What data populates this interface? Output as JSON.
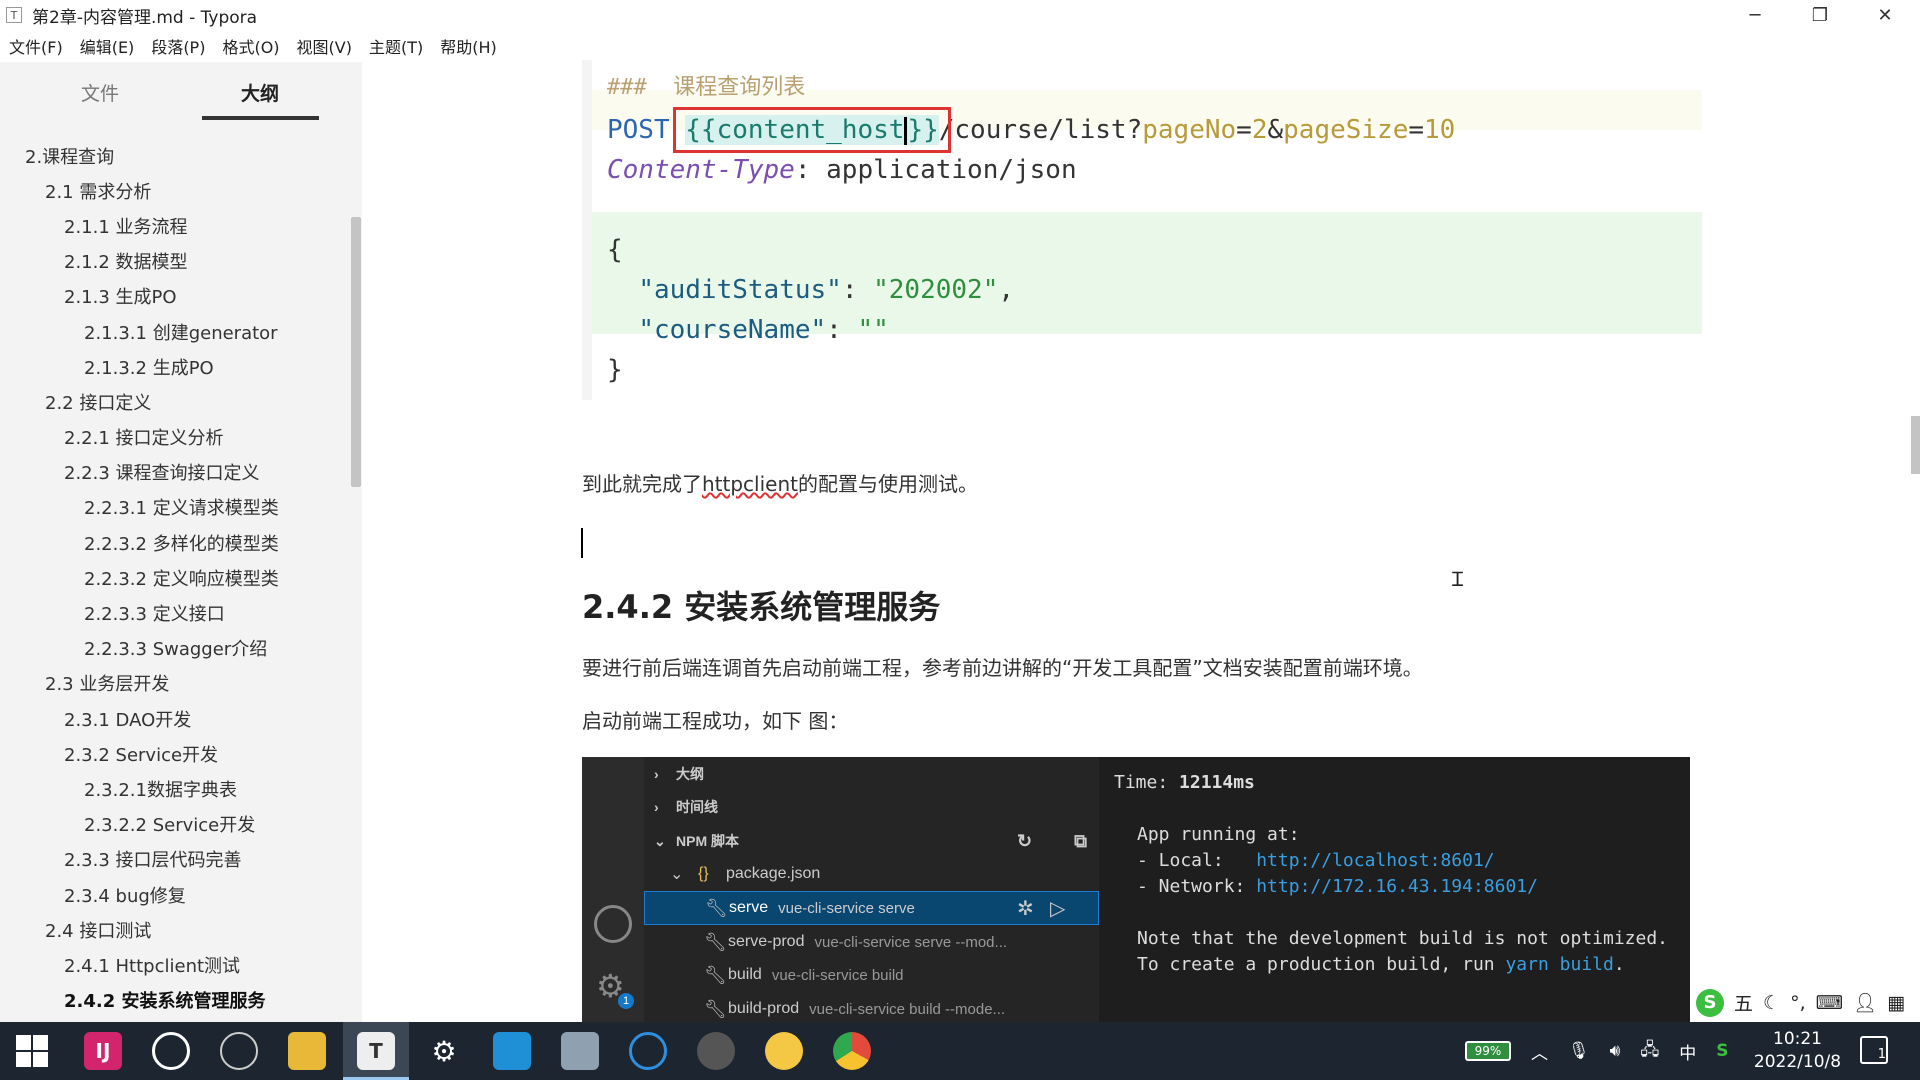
{
  "window": {
    "title": "第2章-内容管理.md - Typora",
    "app_icon": "T",
    "min_glyph": "─",
    "max_glyph": "❐",
    "close_glyph": "✕"
  },
  "menu": [
    "文件(F)",
    "编辑(E)",
    "段落(P)",
    "格式(O)",
    "视图(V)",
    "主题(T)",
    "帮助(H)"
  ],
  "sidebar": {
    "tabs": {
      "files": "文件",
      "outline": "大纲"
    },
    "outline": [
      {
        "label": "2.课程查询",
        "level": 1
      },
      {
        "label": "2.1 需求分析",
        "level": 2
      },
      {
        "label": "2.1.1 业务流程",
        "level": 3
      },
      {
        "label": "2.1.2 数据模型",
        "level": 3
      },
      {
        "label": "2.1.3 生成PO",
        "level": 3
      },
      {
        "label": "2.1.3.1 创建generator",
        "level": 4
      },
      {
        "label": "2.1.3.2 生成PO",
        "level": 4
      },
      {
        "label": "2.2 接口定义",
        "level": 2
      },
      {
        "label": "2.2.1 接口定义分析",
        "level": 3
      },
      {
        "label": "2.2.3 课程查询接口定义",
        "level": 3
      },
      {
        "label": "2.2.3.1 定义请求模型类",
        "level": 4
      },
      {
        "label": "2.2.3.2 多样化的模型类",
        "level": 4
      },
      {
        "label": "2.2.3.2 定义响应模型类",
        "level": 4
      },
      {
        "label": "2.2.3.3 定义接口",
        "level": 4
      },
      {
        "label": "2.2.3.3 Swagger介绍",
        "level": 4
      },
      {
        "label": "2.3 业务层开发",
        "level": 2
      },
      {
        "label": "2.3.1 DAO开发",
        "level": 3
      },
      {
        "label": "2.3.2 Service开发",
        "level": 3
      },
      {
        "label": "2.3.2.1数据字典表",
        "level": 4
      },
      {
        "label": "2.3.2.2 Service开发",
        "level": 4
      },
      {
        "label": "2.3.3 接口层代码完善",
        "level": 3
      },
      {
        "label": "2.3.4 bug修复",
        "level": 3
      },
      {
        "label": "2.4 接口测试",
        "level": 2
      },
      {
        "label": "2.4.1 Httpclient测试",
        "level": 3
      },
      {
        "label": "2.4.2 安装系统管理服务",
        "level": 3,
        "active": true
      }
    ],
    "bottom": {
      "back": "<",
      "source": "</>"
    }
  },
  "editor": {
    "code": {
      "comment_marker": "###",
      "comment_text": "课程查询列表",
      "method": "POST",
      "tpl_open": "{{",
      "tpl_var": "content_host",
      "tpl_close": "}}",
      "path": "/course/list?",
      "param1_key": "pageNo",
      "param1_val": "2",
      "amp": "&",
      "param2_key": "pageSize",
      "param2_val": "10",
      "eq": "=",
      "header_key": "Content-Type",
      "header_sep": ": ",
      "header_val": "application/json",
      "open_brace": "{",
      "audit_key": "\"auditStatus\"",
      "audit_val": "\"202002\"",
      "course_key": "\"courseName\"",
      "course_val": "\"\"",
      "close_brace": "}",
      "colon": ": ",
      "comma": ","
    },
    "para1_pre": "到此就完成了",
    "para1_link": "httpclient",
    "para1_post": "的配置与使用测试。",
    "heading": "2.4.2 安装系统管理服务",
    "para2": "要进行前后端连调首先启动前端工程，参考前边讲解的“开发工具配置”文档安装配置前端环境。",
    "para3": "启动前端工程成功，如下 图："
  },
  "screenshot": {
    "rows": [
      {
        "arrow": "›",
        "label": "大纲"
      },
      {
        "arrow": "›",
        "label": "时间线"
      },
      {
        "arrow": "⌄",
        "label": "NPM 脚本"
      }
    ],
    "package": "package.json",
    "package_icon": "{}",
    "scripts": [
      {
        "name": "serve",
        "cmd": "vue-cli-service serve",
        "selected": true
      },
      {
        "name": "serve-prod",
        "cmd": "vue-cli-service serve --mod..."
      },
      {
        "name": "build",
        "cmd": "vue-cli-service build"
      },
      {
        "name": "build-prod",
        "cmd": "vue-cli-service build --mode..."
      }
    ],
    "badge": "1",
    "terminal": {
      "time_label": "Time: ",
      "time_val": "12114ms",
      "running": "App running at:",
      "local_label": "- Local:   ",
      "local_url": "http://localhost:8601/",
      "network_label": "- Network: ",
      "network_url": "http://172.16.43.194:8601/",
      "note1": "Note that the development build is not optimized.",
      "note2_pre": "To create a production build, run ",
      "note2_cmd": "yarn build",
      "note2_post": "."
    }
  },
  "ime": {
    "logo": "S",
    "mode": "五"
  },
  "taskbar": {
    "battery": "99%",
    "lang": "中",
    "time": "10:21",
    "date": "2022/10/8",
    "notif_count": "1"
  },
  "colors": {
    "highlight_box": "#dd3333",
    "json_bg": "#eaf8e9",
    "taskbar": "#1d2630",
    "selection": "#094771"
  }
}
